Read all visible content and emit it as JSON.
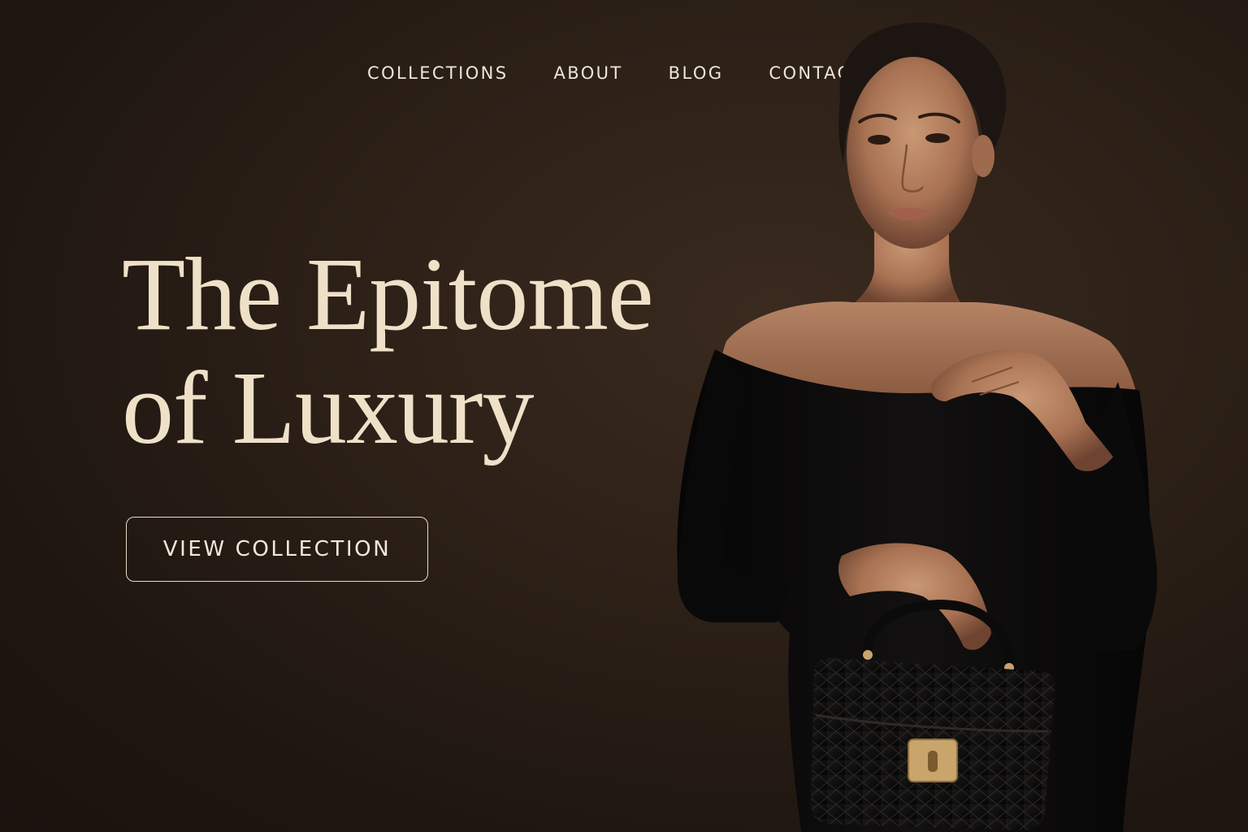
{
  "nav": {
    "items": [
      {
        "label": "COLLECTIONS"
      },
      {
        "label": "ABOUT"
      },
      {
        "label": "BLOG"
      },
      {
        "label": "CONTACT"
      }
    ]
  },
  "hero": {
    "title_line1": "The Epitome",
    "title_line2": "of Luxury",
    "cta_label": "VIEW COLLECTION"
  },
  "colors": {
    "background": "#2a1e16",
    "headline": "#efe1c8",
    "nav_text": "#efe6d8",
    "dress": "#0d0c0c",
    "handbag_clasp": "#c9a46b"
  }
}
